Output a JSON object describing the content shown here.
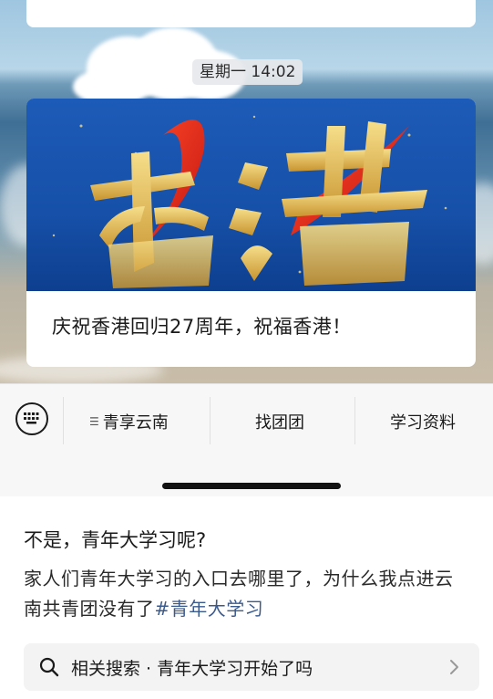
{
  "chat": {
    "timestamp": "星期一 14:02",
    "article": {
      "banner_text": "香港",
      "title": "庆祝香港回归27周年，祝福香港！"
    }
  },
  "menu_bar": {
    "items": [
      {
        "label": "青享云南",
        "has_submenu_icon": true
      },
      {
        "label": "找团团"
      },
      {
        "label": "学习资料"
      }
    ],
    "keyboard_icon": "keyboard-icon"
  },
  "post": {
    "title": "不是，青年大学习呢?",
    "body": "家人们青年大学习的入口去哪里了，为什么我点进云南共青团没有了",
    "hashtag": "#青年大学习",
    "related_search": "相关搜索 · 青年大学习开始了吗"
  },
  "colors": {
    "hashtag": "#3b5a8c",
    "banner_blue": "#1d5bb8",
    "banner_red": "#e0281e",
    "banner_gold": "#e8c25a"
  }
}
